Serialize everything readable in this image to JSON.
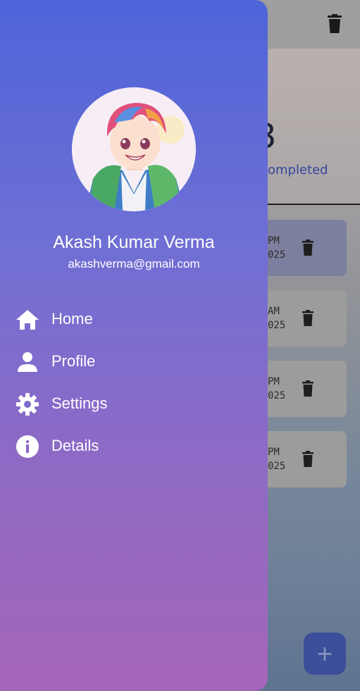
{
  "background": {
    "stat": {
      "number": "3",
      "label": "ompleted"
    },
    "cards": [
      {
        "time": "PM",
        "date": "025"
      },
      {
        "time": "AM",
        "date": "025"
      },
      {
        "time": "PM",
        "date": "025"
      },
      {
        "time": "PM",
        "date": "025"
      }
    ],
    "fab_label": "+"
  },
  "drawer": {
    "user": {
      "name": "Akash Kumar Verma",
      "email": "akashverma@gmail.com"
    },
    "menu": [
      {
        "label": "Home",
        "icon": "home-icon"
      },
      {
        "label": "Profile",
        "icon": "person-icon"
      },
      {
        "label": "Settings",
        "icon": "gear-icon"
      },
      {
        "label": "Details",
        "icon": "info-icon"
      }
    ]
  },
  "colors": {
    "drawer_top": "#4e64d9",
    "drawer_bottom": "#a566b8",
    "text": "#ffffff"
  }
}
